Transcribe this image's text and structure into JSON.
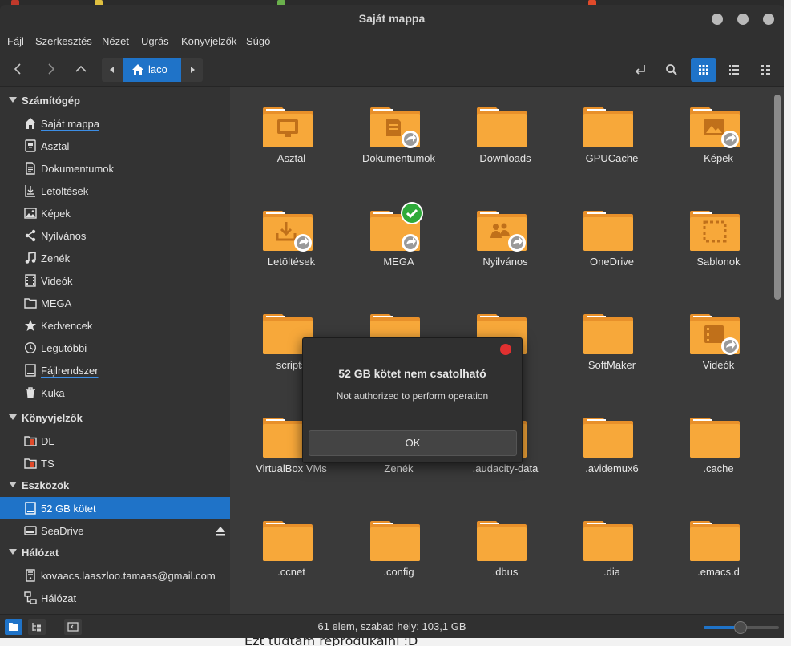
{
  "window": {
    "title": "Saját mappa"
  },
  "menu": [
    "Fájl",
    "Szerkesztés",
    "Nézet",
    "Ugrás",
    "Könyvjelzők",
    "Súgó"
  ],
  "pathbar": {
    "current": "laco"
  },
  "sidebar": {
    "sections": [
      {
        "title": "Számítógép",
        "items": [
          "Saját mappa",
          "Asztal",
          "Dokumentumok",
          "Letöltések",
          "Képek",
          "Nyilvános",
          "Zenék",
          "Videók",
          "MEGA",
          "Kedvencek",
          "Legutóbbi",
          "Fájlrendszer",
          "Kuka"
        ]
      },
      {
        "title": "Könyvjelzők",
        "items": [
          "DL",
          "TS"
        ]
      },
      {
        "title": "Eszközök",
        "items": [
          "52 GB kötet",
          "SeaDrive"
        ]
      },
      {
        "title": "Hálózat",
        "items": [
          "kovaacs.laaszloo.tamaas@gmail.com",
          "Hálózat"
        ]
      }
    ],
    "selected": "52 GB kötet"
  },
  "files": [
    "Asztal",
    "Dokumentumok",
    "Downloads",
    "GPUCache",
    "Képek",
    "Letöltések",
    "MEGA",
    "Nyilvános",
    "OneDrive",
    "Sablonok",
    "scripts",
    "",
    "",
    "SoftMaker",
    "Videók",
    "VirtualBox VMs",
    "Zenék",
    ".audacity-data",
    ".avidemux6",
    ".cache",
    ".ccnet",
    ".config",
    ".dbus",
    ".dia",
    ".emacs.d"
  ],
  "status": {
    "text": "61 elem, szabad hely: 103,1 GB",
    "zoom": 0.5
  },
  "dialog": {
    "title": "52 GB kötet nem csatolható",
    "message": "Not authorized to perform operation",
    "ok": "OK"
  },
  "background_text": "Ezt tudtam reprodukálni :D",
  "colors": {
    "accent": "#1f73c8",
    "folder": "#f7a83a",
    "folder_dark": "#e8902a"
  }
}
